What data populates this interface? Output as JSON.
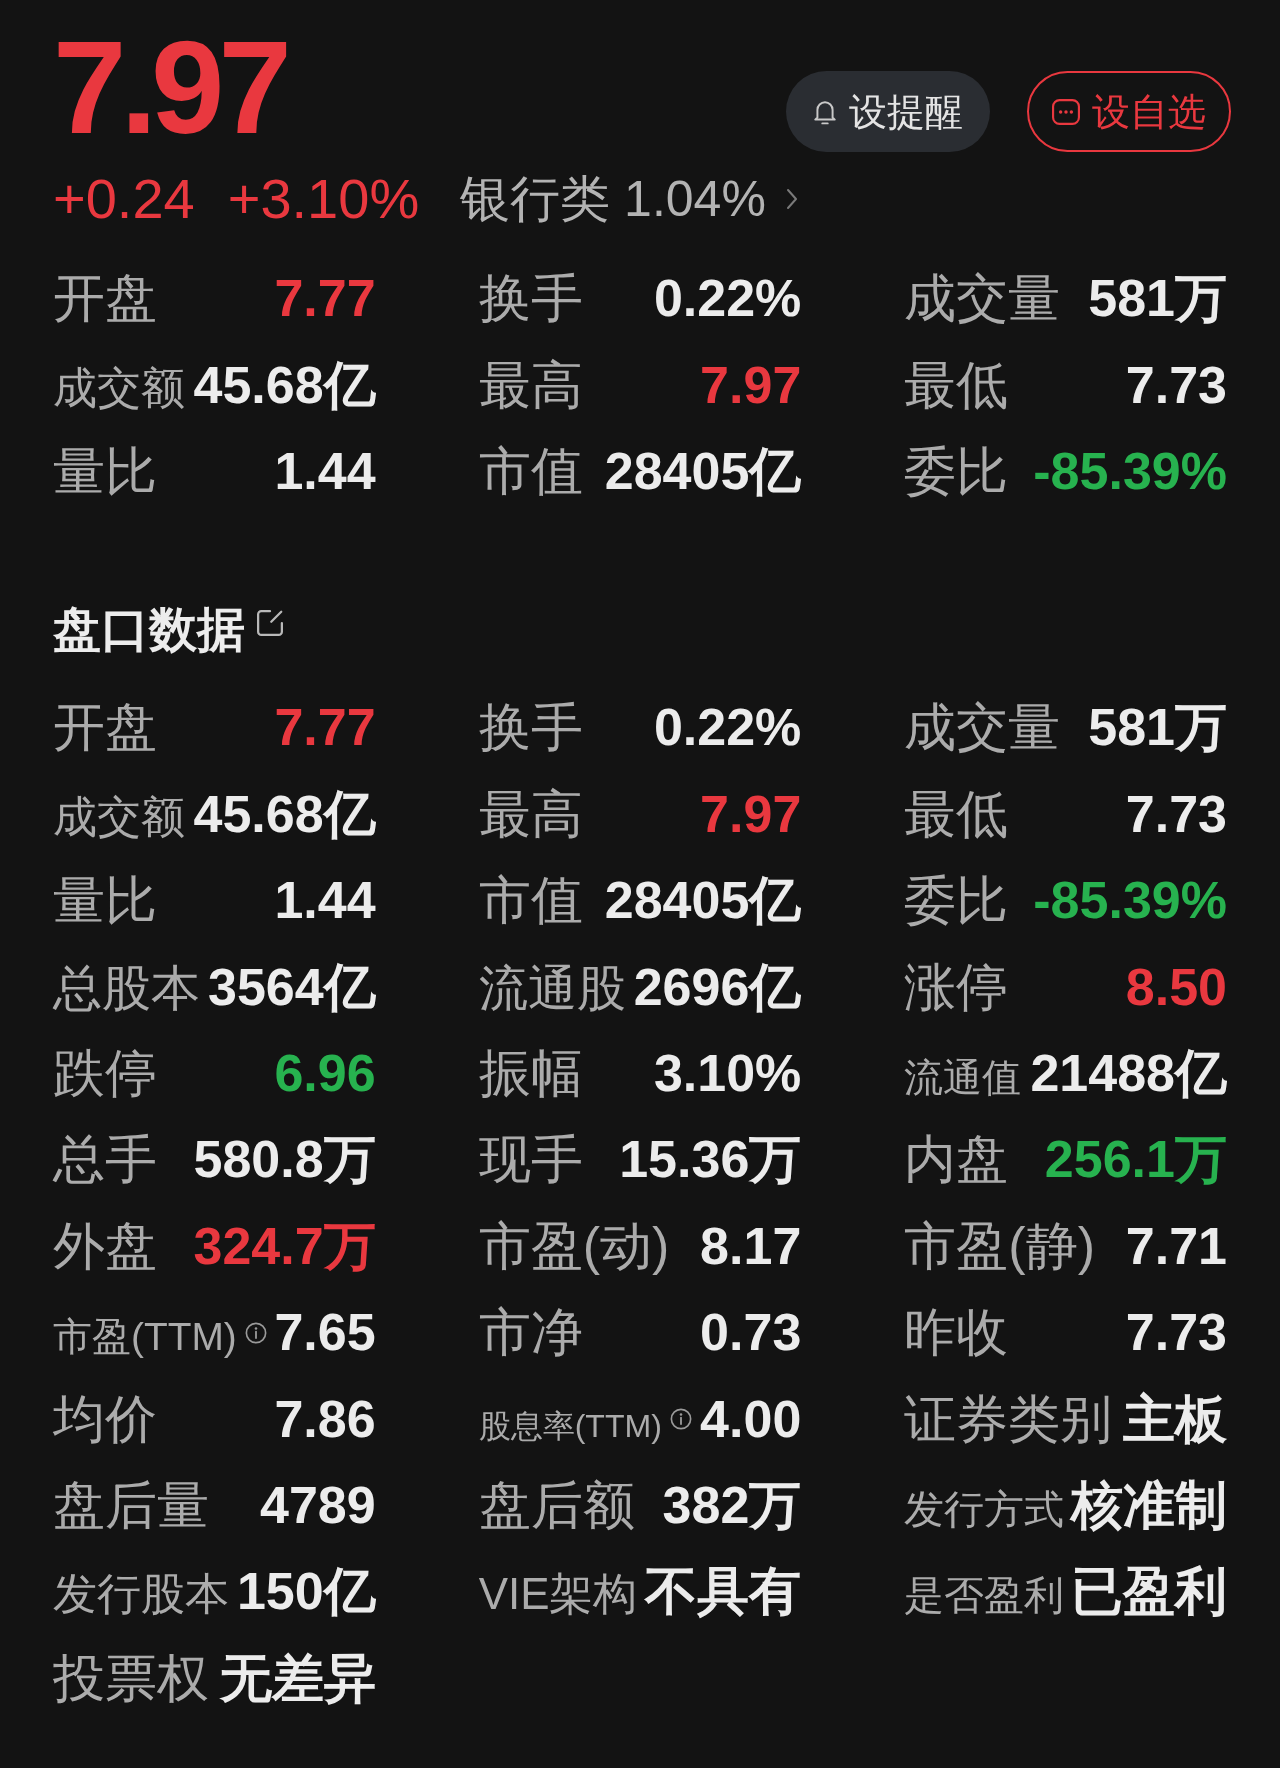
{
  "quote": {
    "price": "7.97",
    "change": "+0.24",
    "change_percent": "+3.10%"
  },
  "sector": {
    "name": "银行类",
    "change": "1.04%"
  },
  "buttons": [
    {
      "kind": "alert",
      "label": "设提醒"
    },
    {
      "kind": "watchlist",
      "label": "设自选"
    }
  ],
  "summary": [
    {
      "label": "开盘",
      "value": "7.77",
      "color": "#e9383f"
    },
    {
      "label": "换手",
      "value": "0.22%",
      "color": "#ececec"
    },
    {
      "label": "成交量",
      "value": "581万",
      "color": "#ececec"
    },
    {
      "label": "成交额",
      "value": "45.68亿",
      "color": "#ececec"
    },
    {
      "label": "最高",
      "value": "7.97",
      "color": "#e9383f"
    },
    {
      "label": "最低",
      "value": "7.73",
      "color": "#ececec"
    },
    {
      "label": "量比",
      "value": "1.44",
      "color": "#ececec"
    },
    {
      "label": "市值",
      "value": "28405亿",
      "color": "#ececec"
    },
    {
      "label": "委比",
      "value": "-85.39%",
      "color": "#27b24f"
    }
  ],
  "order_book": {
    "title": "盘口数据",
    "items": [
      {
        "label": "开盘",
        "value": "7.77",
        "color": "#e9383f"
      },
      {
        "label": "换手",
        "value": "0.22%",
        "color": "#ececec"
      },
      {
        "label": "成交量",
        "value": "581万",
        "color": "#ececec"
      },
      {
        "label": "成交额",
        "value": "45.68亿",
        "color": "#ececec"
      },
      {
        "label": "最高",
        "value": "7.97",
        "color": "#e9383f"
      },
      {
        "label": "最低",
        "value": "7.73",
        "color": "#ececec"
      },
      {
        "label": "量比",
        "value": "1.44",
        "color": "#ececec"
      },
      {
        "label": "市值",
        "value": "28405亿",
        "color": "#ececec"
      },
      {
        "label": "委比",
        "value": "-85.39%",
        "color": "#27b24f"
      },
      {
        "label": "总股本",
        "value": "3564亿",
        "color": "#ececec"
      },
      {
        "label": "流通股",
        "value": "2696亿",
        "color": "#ececec"
      },
      {
        "label": "涨停",
        "value": "8.50",
        "color": "#e9383f"
      },
      {
        "label": "跌停",
        "value": "6.96",
        "color": "#27b24f"
      },
      {
        "label": "振幅",
        "value": "3.10%",
        "color": "#ececec"
      },
      {
        "label": "流通值",
        "value": "21488亿",
        "color": "#ececec"
      },
      {
        "label": "总手",
        "value": "580.8万",
        "color": "#ececec"
      },
      {
        "label": "现手",
        "value": "15.36万",
        "color": "#ececec"
      },
      {
        "label": "内盘",
        "value": "256.1万",
        "color": "#27b24f"
      },
      {
        "label": "外盘",
        "value": "324.7万",
        "color": "#e9383f"
      },
      {
        "label": "市盈(动)",
        "value": "8.17",
        "color": "#ececec"
      },
      {
        "label": "市盈(静)",
        "value": "7.71",
        "color": "#ececec"
      },
      {
        "label": "市盈(TTM)",
        "value": "7.65",
        "color": "#ececec",
        "info": true
      },
      {
        "label": "市净",
        "value": "0.73",
        "color": "#ececec"
      },
      {
        "label": "昨收",
        "value": "7.73",
        "color": "#ececec"
      },
      {
        "label": "均价",
        "value": "7.86",
        "color": "#ececec"
      },
      {
        "label": "股息率(TTM)",
        "value": "4.00",
        "color": "#ececec",
        "info": true
      },
      {
        "label": "证券类别",
        "value": "主板",
        "color": "#ececec"
      },
      {
        "label": "盘后量",
        "value": "4789",
        "color": "#ececec"
      },
      {
        "label": "盘后额",
        "value": "382万",
        "color": "#ececec"
      },
      {
        "label": "发行方式",
        "value": "核准制",
        "color": "#ececec"
      },
      {
        "label": "发行股本",
        "value": "150亿",
        "color": "#ececec"
      },
      {
        "label": "VIE架构",
        "value": "不具有",
        "color": "#ececec"
      },
      {
        "label": "是否盈利",
        "value": "已盈利",
        "color": "#ececec"
      },
      {
        "label": "投票权",
        "value": "无差异",
        "color": "#ececec"
      }
    ]
  }
}
